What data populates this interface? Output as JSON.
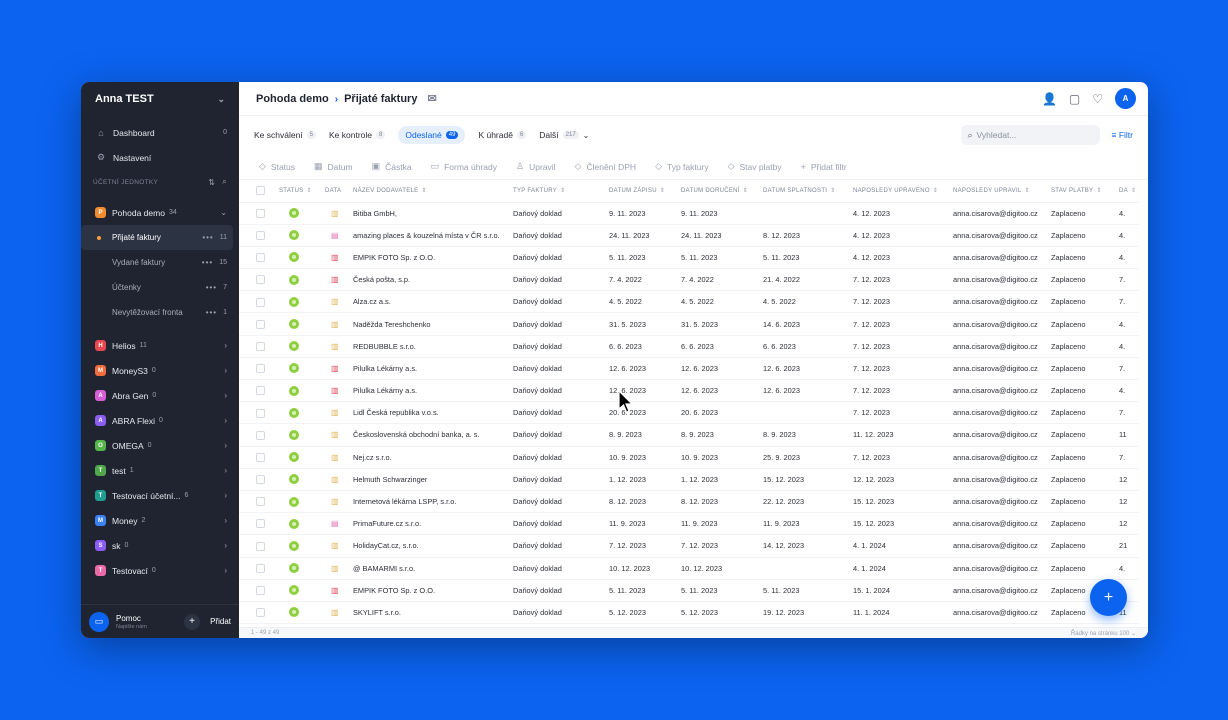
{
  "sidebar": {
    "user": "Anna TEST",
    "dashboard": {
      "label": "Dashboard",
      "count": "0"
    },
    "settings": {
      "label": "Nastavení"
    },
    "section_title": "ÚČETNÍ JEDNOTKY",
    "units": [
      {
        "label": "Pohoda demo",
        "count": "34",
        "letter": "P",
        "color": "#f28b30",
        "expanded": true
      },
      {
        "label": "Helios",
        "count": "11",
        "letter": "H",
        "color": "#e8474f"
      },
      {
        "label": "MoneyS3",
        "count": "0",
        "letter": "M",
        "color": "#f26b3a"
      },
      {
        "label": "Abra Gen",
        "count": "0",
        "letter": "A",
        "color": "#d65fd6"
      },
      {
        "label": "ABRA Flexi",
        "count": "0",
        "letter": "A",
        "color": "#8a5cf0"
      },
      {
        "label": "OMEGA",
        "count": "0",
        "letter": "O",
        "color": "#55b54a"
      },
      {
        "label": "test",
        "count": "1",
        "letter": "T",
        "color": "#4fa84a"
      },
      {
        "label": "Testovací účetní...",
        "count": "6",
        "letter": "T",
        "color": "#1f9e8f"
      },
      {
        "label": "Money",
        "count": "2",
        "letter": "M",
        "color": "#3b82f6"
      },
      {
        "label": "sk",
        "count": "0",
        "letter": "S",
        "color": "#8b5cf6"
      },
      {
        "label": "Testovací",
        "count": "0",
        "letter": "T",
        "color": "#ec6aa8"
      }
    ],
    "subitems": [
      {
        "label": "Přijaté faktury",
        "count": "11",
        "active": true
      },
      {
        "label": "Vydané faktury",
        "count": "15"
      },
      {
        "label": "Účtenky",
        "count": "7"
      },
      {
        "label": "Nevytěžovací fronta",
        "count": "1"
      }
    ],
    "help": {
      "title": "Pomoc",
      "subtitle": "Napište nám"
    },
    "add": "Přidat"
  },
  "header": {
    "crumb1": "Pohoda demo",
    "crumb2": "Přijaté faktury"
  },
  "tabs": [
    {
      "label": "Ke schválení",
      "count": "5"
    },
    {
      "label": "Ke kontrole",
      "count": "8"
    },
    {
      "label": "Odeslané",
      "count": "49",
      "active": true
    },
    {
      "label": "K úhradě",
      "count": "6"
    },
    {
      "label": "Další",
      "count": "217"
    }
  ],
  "search": {
    "placeholder": "Vyhledat..."
  },
  "filter_button": "Filtr",
  "filters": [
    {
      "label": "Status",
      "icon": "tag-icon"
    },
    {
      "label": "Datum",
      "icon": "calendar-icon"
    },
    {
      "label": "Částka",
      "icon": "money-icon"
    },
    {
      "label": "Forma úhrady",
      "icon": "card-icon"
    },
    {
      "label": "Upravil",
      "icon": "user-icon"
    },
    {
      "label": "Členění DPH",
      "icon": "tag-icon"
    },
    {
      "label": "Typ faktury",
      "icon": "tag-icon"
    },
    {
      "label": "Stav platby",
      "icon": "tag-icon"
    },
    {
      "label": "Přidat filtr",
      "icon": "plus-icon"
    }
  ],
  "columns": [
    "STATUS",
    "DATA",
    "NÁZEV DODAVATELE",
    "TYP FAKTURY",
    "DATUM ZÁPISU",
    "DATUM DORUČENÍ",
    "DATUM SPLATNOSTI",
    "NAPOSLEDY UPRAVENO",
    "NAPOSLEDY UPRAVIL",
    "STAV PLATBY",
    "DA"
  ],
  "rows": [
    {
      "doc": "y",
      "name": "Bitiba GmbH,",
      "type": "Daňový doklad",
      "zap": "9. 11. 2023",
      "dor": "9. 11. 2023",
      "spl": "",
      "upr": "4. 12. 2023",
      "by": "anna.cisarova@digitoo.cz",
      "pay": "Zaplaceno",
      "da": "4."
    },
    {
      "doc": "p",
      "name": "amazing places & kouzelná místa v ČR s.r.o.",
      "type": "Daňový doklad",
      "zap": "24. 11. 2023",
      "dor": "24. 11. 2023",
      "spl": "8. 12. 2023",
      "upr": "4. 12. 2023",
      "by": "anna.cisarova@digitoo.cz",
      "pay": "Zaplaceno",
      "da": "4."
    },
    {
      "doc": "r",
      "name": "EMPIK FOTO Sp. z O.O.",
      "type": "Daňový doklad",
      "zap": "5. 11. 2023",
      "dor": "5. 11. 2023",
      "spl": "5. 11. 2023",
      "upr": "4. 12. 2023",
      "by": "anna.cisarova@digitoo.cz",
      "pay": "Zaplaceno",
      "da": "4."
    },
    {
      "doc": "r",
      "name": "Česká pošta, s.p.",
      "type": "Daňový doklad",
      "zap": "7. 4. 2022",
      "dor": "7. 4. 2022",
      "spl": "21. 4. 2022",
      "upr": "7. 12. 2023",
      "by": "anna.cisarova@digitoo.cz",
      "pay": "Zaplaceno",
      "da": "7."
    },
    {
      "doc": "y",
      "name": "Alza.cz a.s.",
      "type": "Daňový doklad",
      "zap": "4. 5. 2022",
      "dor": "4. 5. 2022",
      "spl": "4. 5. 2022",
      "upr": "7. 12. 2023",
      "by": "anna.cisarova@digitoo.cz",
      "pay": "Zaplaceno",
      "da": "7."
    },
    {
      "doc": "y",
      "name": "Naděžda Tereshchenko",
      "type": "Daňový doklad",
      "zap": "31. 5. 2023",
      "dor": "31. 5. 2023",
      "spl": "14. 6. 2023",
      "upr": "7. 12. 2023",
      "by": "anna.cisarova@digitoo.cz",
      "pay": "Zaplaceno",
      "da": "4."
    },
    {
      "doc": "y",
      "name": "REDBUBBLE s.r.o.",
      "type": "Daňový doklad",
      "zap": "6. 6. 2023",
      "dor": "6. 6. 2023",
      "spl": "6. 6. 2023",
      "upr": "7. 12. 2023",
      "by": "anna.cisarova@digitoo.cz",
      "pay": "Zaplaceno",
      "da": "4."
    },
    {
      "doc": "r",
      "name": "Pilulka Lékárny a.s.",
      "type": "Daňový doklad",
      "zap": "12. 6. 2023",
      "dor": "12. 6. 2023",
      "spl": "12. 6. 2023",
      "upr": "7. 12. 2023",
      "by": "anna.cisarova@digitoo.cz",
      "pay": "Zaplaceno",
      "da": "7."
    },
    {
      "doc": "r",
      "name": "Pilulka Lékárny a.s.",
      "type": "Daňový doklad",
      "zap": "12. 6. 2023",
      "dor": "12. 6. 2023",
      "spl": "12. 6. 2023",
      "upr": "7. 12. 2023",
      "by": "anna.cisarova@digitoo.cz",
      "pay": "Zaplaceno",
      "da": "4."
    },
    {
      "doc": "y",
      "name": "Lidl Česká republika v.o.s.",
      "type": "Daňový doklad",
      "zap": "20. 6. 2023",
      "dor": "20. 6. 2023",
      "spl": "",
      "upr": "7. 12. 2023",
      "by": "anna.cisarova@digitoo.cz",
      "pay": "Zaplaceno",
      "da": "7."
    },
    {
      "doc": "y",
      "name": "Československá obchodní banka, a. s.",
      "type": "Daňový doklad",
      "zap": "8. 9. 2023",
      "dor": "8. 9. 2023",
      "spl": "8. 9. 2023",
      "upr": "11. 12. 2023",
      "by": "anna.cisarova@digitoo.cz",
      "pay": "Zaplaceno",
      "da": "11"
    },
    {
      "doc": "y",
      "name": "Nej.cz s.r.o.",
      "type": "Daňový doklad",
      "zap": "10. 9. 2023",
      "dor": "10. 9. 2023",
      "spl": "25. 9. 2023",
      "upr": "7. 12. 2023",
      "by": "anna.cisarova@digitoo.cz",
      "pay": "Zaplaceno",
      "da": "7."
    },
    {
      "doc": "y",
      "name": "Helmuth Schwarzinger",
      "type": "Daňový doklad",
      "zap": "1. 12. 2023",
      "dor": "1. 12. 2023",
      "spl": "15. 12. 2023",
      "upr": "12. 12. 2023",
      "by": "anna.cisarova@digitoo.cz",
      "pay": "Zaplaceno",
      "da": "12"
    },
    {
      "doc": "y",
      "name": "Internetová lékárna LSPP, s.r.o.",
      "type": "Daňový doklad",
      "zap": "8. 12. 2023",
      "dor": "8. 12. 2023",
      "spl": "22. 12. 2023",
      "upr": "15. 12. 2023",
      "by": "anna.cisarova@digitoo.cz",
      "pay": "Zaplaceno",
      "da": "12"
    },
    {
      "doc": "p",
      "name": "PrimaFuture.cz s.r.o.",
      "type": "Daňový doklad",
      "zap": "11. 9. 2023",
      "dor": "11. 9. 2023",
      "spl": "11. 9. 2023",
      "upr": "15. 12. 2023",
      "by": "anna.cisarova@digitoo.cz",
      "pay": "Zaplaceno",
      "da": "12"
    },
    {
      "doc": "y",
      "name": "HolidayCat.cz, s.r.o.",
      "type": "Daňový doklad",
      "zap": "7. 12. 2023",
      "dor": "7. 12. 2023",
      "spl": "14. 12. 2023",
      "upr": "4. 1. 2024",
      "by": "anna.cisarova@digitoo.cz",
      "pay": "Zaplaceno",
      "da": "21"
    },
    {
      "doc": "y",
      "name": "@ BAMARMI s.r.o.",
      "type": "Daňový doklad",
      "zap": "10. 12. 2023",
      "dor": "10. 12. 2023",
      "spl": "",
      "upr": "4. 1. 2024",
      "by": "anna.cisarova@digitoo.cz",
      "pay": "Zaplaceno",
      "da": "4."
    },
    {
      "doc": "r",
      "name": "EMPIK FOTO Sp. z O.O.",
      "type": "Daňový doklad",
      "zap": "5. 11. 2023",
      "dor": "5. 11. 2023",
      "spl": "5. 11. 2023",
      "upr": "15. 1. 2024",
      "by": "anna.cisarova@digitoo.cz",
      "pay": "Zaplaceno",
      "da": "4."
    },
    {
      "doc": "y",
      "name": "SKYLIFT s.r.o.",
      "type": "Daňový doklad",
      "zap": "5. 12. 2023",
      "dor": "5. 12. 2023",
      "spl": "19. 12. 2023",
      "upr": "11. 1. 2024",
      "by": "anna.cisarova@digitoo.cz",
      "pay": "Zaplaceno",
      "da": "11"
    }
  ],
  "footer": {
    "range": "1 - 49 z 49",
    "per_page_label": "Řádky na stránku",
    "per_page": "100"
  }
}
